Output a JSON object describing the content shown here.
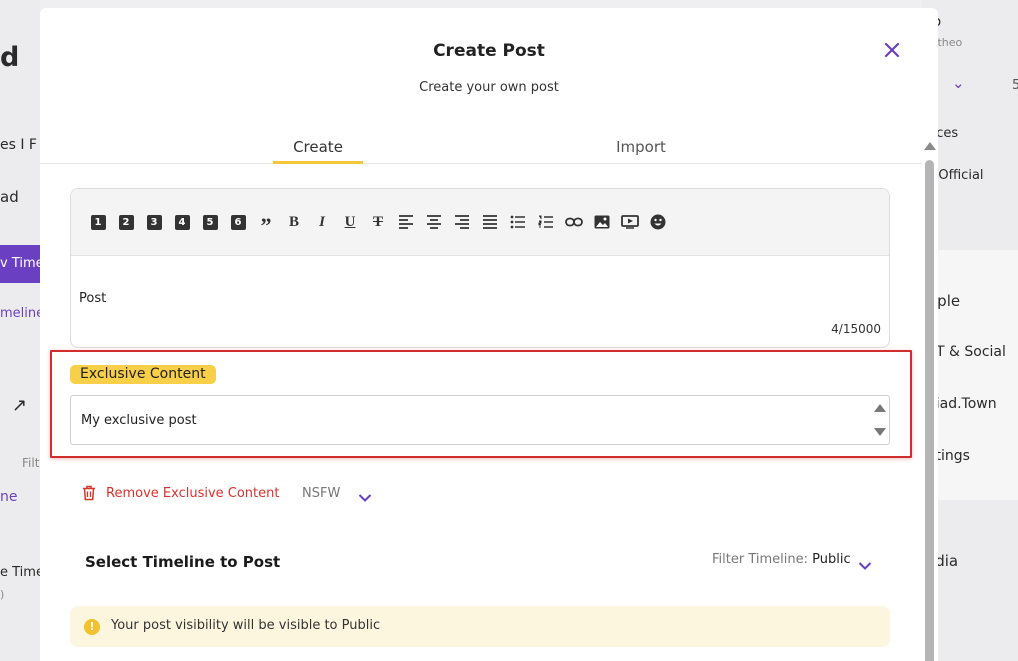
{
  "background": {
    "left_fragments": [
      "d",
      "es I F",
      "ad",
      "v Time",
      "meline",
      "Filt",
      "ne",
      "e Timel",
      ")"
    ],
    "right_fragments": [
      "eo",
      "eotheo",
      "o",
      "5",
      "nces",
      "d Official",
      "ople",
      "T & Social",
      "riad.Town",
      "ttings",
      "edia"
    ]
  },
  "modal": {
    "title": "Create Post",
    "subtitle": "Create your own post",
    "close_icon": "close-icon"
  },
  "tabs": [
    {
      "label": "Create",
      "active": true
    },
    {
      "label": "Import",
      "active": false
    }
  ],
  "editor": {
    "toolbar": [
      {
        "icon": "heading-1-icon",
        "glyph": "1"
      },
      {
        "icon": "heading-2-icon",
        "glyph": "2"
      },
      {
        "icon": "heading-3-icon",
        "glyph": "3"
      },
      {
        "icon": "heading-4-icon",
        "glyph": "4"
      },
      {
        "icon": "heading-5-icon",
        "glyph": "5"
      },
      {
        "icon": "heading-6-icon",
        "glyph": "6"
      },
      {
        "icon": "quote-icon",
        "glyph": "”"
      },
      {
        "icon": "bold-icon",
        "glyph": "B"
      },
      {
        "icon": "italic-icon",
        "glyph": "I"
      },
      {
        "icon": "underline-icon",
        "glyph": "U"
      },
      {
        "icon": "strikethrough-icon",
        "glyph": "T"
      },
      {
        "icon": "align-left-icon",
        "glyph": ""
      },
      {
        "icon": "align-center-icon",
        "glyph": ""
      },
      {
        "icon": "align-right-icon",
        "glyph": ""
      },
      {
        "icon": "align-justify-icon",
        "glyph": ""
      },
      {
        "icon": "bullet-list-icon",
        "glyph": ""
      },
      {
        "icon": "numbered-list-icon",
        "glyph": ""
      },
      {
        "icon": "link-icon",
        "glyph": ""
      },
      {
        "icon": "image-icon",
        "glyph": ""
      },
      {
        "icon": "video-icon",
        "glyph": ""
      },
      {
        "icon": "emoji-icon",
        "glyph": ""
      }
    ],
    "content": "Post",
    "counter": "4/15000"
  },
  "exclusive": {
    "label": "Exclusive Content",
    "value": "My exclusive post",
    "highlight_color": "#d12d2d",
    "label_color": "#f8cf48"
  },
  "actions": {
    "remove_label": "Remove Exclusive Content",
    "remove_color": "#d9322c",
    "nsfw_label": "NSFW"
  },
  "timeline": {
    "title": "Select Timeline to Post",
    "filter_label": "Filter Timeline:",
    "filter_value": "Public"
  },
  "notice": {
    "text": "Your post visibility will be visible to Public"
  },
  "colors": {
    "accent": "#6a3fc2",
    "tab_underline": "#f3c83a"
  }
}
